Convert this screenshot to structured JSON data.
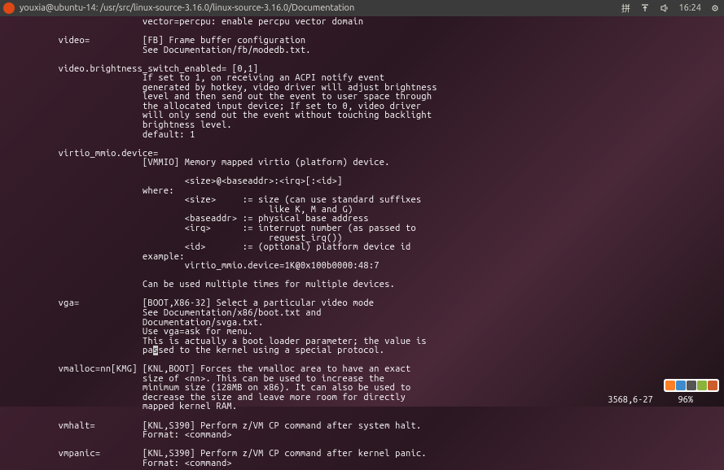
{
  "topbar": {
    "title": "youxia@ubuntu-14: /usr/src/linux-source-3.16.0/linux-source-3.16.0/Documentation",
    "time": "16:24"
  },
  "terminal": {
    "lines": [
      "                        vector=percpu: enable percpu vector domain",
      "",
      "        video=          [FB] Frame buffer configuration",
      "                        See Documentation/fb/modedb.txt.",
      "",
      "        video.brightness_switch_enabled= [0,1]",
      "                        If set to 1, on receiving an ACPI notify event",
      "                        generated by hotkey, video driver will adjust brightness",
      "                        level and then send out the event to user space through",
      "                        the allocated input device; If set to 0, video driver",
      "                        will only send out the event without touching backlight",
      "                        brightness level.",
      "                        default: 1",
      "",
      "        virtio_mmio.device=",
      "                        [VMMIO] Memory mapped virtio (platform) device.",
      "",
      "                                <size>@<baseaddr>:<irq>[:<id>]",
      "                        where:",
      "                                <size>     := size (can use standard suffixes",
      "                                                like K, M and G)",
      "                                <baseaddr> := physical base address",
      "                                <irq>      := interrupt number (as passed to",
      "                                                request_irq())",
      "                                <id>       := (optional) platform device id",
      "                        example:",
      "                                virtio_mmio.device=1K@0x100b0000:48:7",
      "",
      "                        Can be used multiple times for multiple devices.",
      "",
      "        vga=            [BOOT,X86-32] Select a particular video mode",
      "                        See Documentation/x86/boot.txt and",
      "                        Documentation/svga.txt.",
      "                        Use vga=ask for menu.",
      "                        This is actually a boot loader parameter; the value is",
      "                        pa",
      "sed to the kernel using a special protocol.",
      "",
      "        vmalloc=nn[KMG] [KNL,BOOT] Forces the vmalloc area to have an exact",
      "                        size of <nn>. This can be used to increase the",
      "                        minimum size (128MB on x86). It can also be used to",
      "                        decrease the size and leave more room for directly",
      "                        mapped kernel RAM.",
      "",
      "        vmhalt=         [KNL,S390] Perform z/VM CP command after system halt.",
      "                        Format: <command>",
      "",
      "        vmpanic=        [KNL,S390] Perform z/VM CP command after kernel panic.",
      "                        Format: <command>"
    ],
    "cursor_char": "s",
    "cursor_line_index": 35
  },
  "status": {
    "position": "3568,6-27",
    "percent": "96%"
  }
}
